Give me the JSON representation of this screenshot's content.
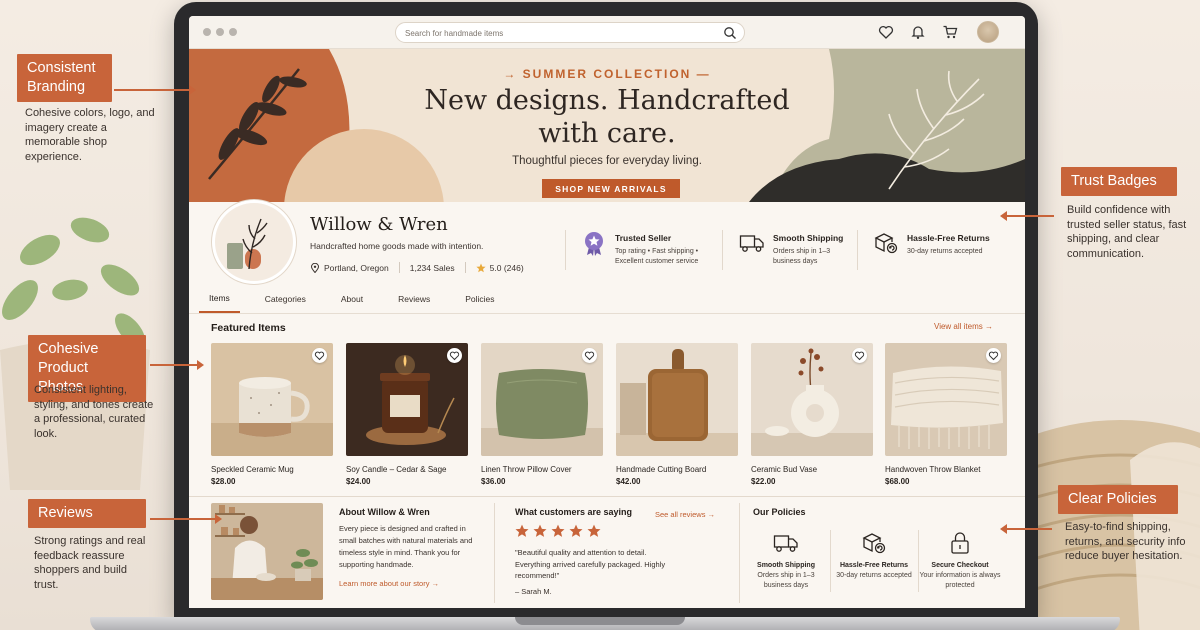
{
  "browser": {
    "search_placeholder": "Search for handmade items"
  },
  "hero": {
    "kicker": "SUMMER COLLECTION",
    "title": "New designs. Handcrafted with care.",
    "subtitle": "Thoughtful pieces for everyday living.",
    "cta_label": "SHOP NEW ARRIVALS"
  },
  "shop": {
    "name": "Willow & Wren",
    "tagline": "Handcrafted home goods made with intention.",
    "location": "Portland, Oregon",
    "sales": "1,234 Sales",
    "rating": "5.0",
    "rating_count": "(246)"
  },
  "trust_badges": [
    {
      "title": "Trusted Seller",
      "desc": "Top rating • Fast shipping • Excellent customer service",
      "icon": "award-ribbon-icon"
    },
    {
      "title": "Smooth Shipping",
      "desc": "Orders ship in 1–3 business days",
      "icon": "truck-icon"
    },
    {
      "title": "Hassle-Free Returns",
      "desc": "30-day returns accepted",
      "icon": "return-box-icon"
    }
  ],
  "tabs": [
    "Items",
    "Categories",
    "About",
    "Reviews",
    "Policies"
  ],
  "featured": {
    "title": "Featured Items",
    "view_all": "View all items →",
    "products": [
      {
        "name": "Speckled Ceramic Mug",
        "price": "$28.00"
      },
      {
        "name": "Soy Candle – Cedar & Sage",
        "price": "$24.00"
      },
      {
        "name": "Linen Throw Pillow Cover",
        "price": "$36.00"
      },
      {
        "name": "Handmade Cutting Board",
        "price": "$42.00"
      },
      {
        "name": "Ceramic Bud Vase",
        "price": "$22.00"
      },
      {
        "name": "Handwoven Throw Blanket",
        "price": "$68.00"
      }
    ]
  },
  "about": {
    "title": "About Willow & Wren",
    "body": "Every piece is designed and crafted in small batches with natural materials and timeless style in mind. Thank you for supporting handmade.",
    "link": "Learn more about our story →"
  },
  "reviews": {
    "title": "What customers are saying",
    "see_all": "See all reviews →",
    "stars": 5,
    "quote": "\"Beautiful quality and attention to detail. Everything arrived carefully packaged. Highly recommend!\"",
    "author": "–  Sarah M."
  },
  "policies": {
    "title": "Our Policies",
    "items": [
      {
        "title": "Smooth Shipping",
        "desc": "Orders ship in 1–3 business days",
        "icon": "truck-icon"
      },
      {
        "title": "Hassle-Free Returns",
        "desc": "30-day returns accepted",
        "icon": "return-box-icon"
      },
      {
        "title": "Secure Checkout",
        "desc": "Your information is always protected",
        "icon": "lock-icon"
      }
    ]
  },
  "annotations": [
    {
      "title": "Consistent Branding",
      "text": "Cohesive colors, logo, and imagery create a memorable shop experience."
    },
    {
      "title": "Cohesive Product Photos",
      "text": "Consistent lighting, styling, and tones create a professional, curated look."
    },
    {
      "title": "Reviews",
      "text": "Strong ratings and real feedback reassure shoppers and build trust."
    },
    {
      "title": "Trust Badges",
      "text": "Build confidence with trusted seller status, fast shipping, and clear communication."
    },
    {
      "title": "Clear Policies",
      "text": "Easy-to-find shipping, returns, and security info reduce buyer hesitation."
    }
  ],
  "colors": {
    "accent": "#bf5a2b",
    "callout": "#c8643a",
    "background": "#f4ece3"
  }
}
